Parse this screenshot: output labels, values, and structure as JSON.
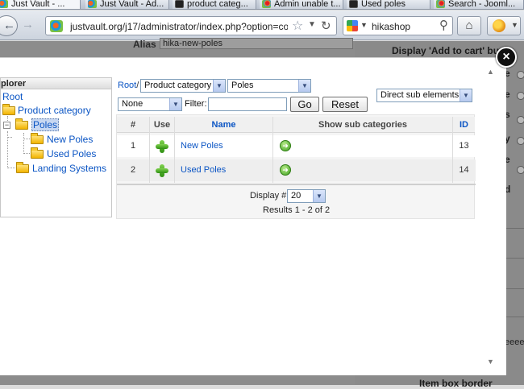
{
  "browser": {
    "tabs": [
      {
        "label": "Just Vault - ...",
        "icon": "joomla-icon",
        "active": true
      },
      {
        "label": "Just Vault - Ad...",
        "icon": "joomla-icon",
        "active": false
      },
      {
        "label": "product categ...",
        "icon": "hikashop-icon",
        "active": false
      },
      {
        "label": "Admin unable t...",
        "icon": "joomla-icon",
        "active": false
      },
      {
        "label": "Used poles",
        "icon": "hikashop-icon",
        "active": false
      },
      {
        "label": "Search - Jooml...",
        "icon": "joomla-icon",
        "active": false
      }
    ],
    "url": "justvault.org/j17/administrator/index.php?option=com_",
    "search_value": "hikashop"
  },
  "background": {
    "alias_label": "Alias",
    "alias_value": "hika-new-poles",
    "add_to_cart_label": "Display 'Add to cart' bu",
    "side_labels": [
      "e",
      "e",
      "s",
      "y",
      "e",
      "d"
    ],
    "eeee_text": "eeee",
    "item_box_border_label": "Item box border"
  },
  "modal": {
    "close_label": "×",
    "explorer": {
      "title": "plorer",
      "items": [
        {
          "label": "Root"
        },
        {
          "label": "Product category"
        },
        {
          "label": "Poles"
        },
        {
          "label": "New Poles"
        },
        {
          "label": "Used Poles"
        },
        {
          "label": "Landing Systems"
        }
      ]
    },
    "breadcrumb_root": "Root",
    "breadcrumb_sep": "/",
    "category_select": "Product category",
    "sub_select": "Poles",
    "scope_select": "Direct sub elements",
    "status_select": "None",
    "filter_label": "Filter:",
    "filter_value": "",
    "go_label": "Go",
    "reset_label": "Reset",
    "table": {
      "headers": [
        "#",
        "Use",
        "Name",
        "Show sub categories",
        "ID"
      ],
      "rows": [
        {
          "num": "1",
          "name": "New Poles",
          "id": "13"
        },
        {
          "num": "2",
          "name": "Used Poles",
          "id": "14"
        }
      ]
    },
    "display_label": "Display #",
    "display_value": "20",
    "results_text": "Results 1 - 2 of 2"
  }
}
